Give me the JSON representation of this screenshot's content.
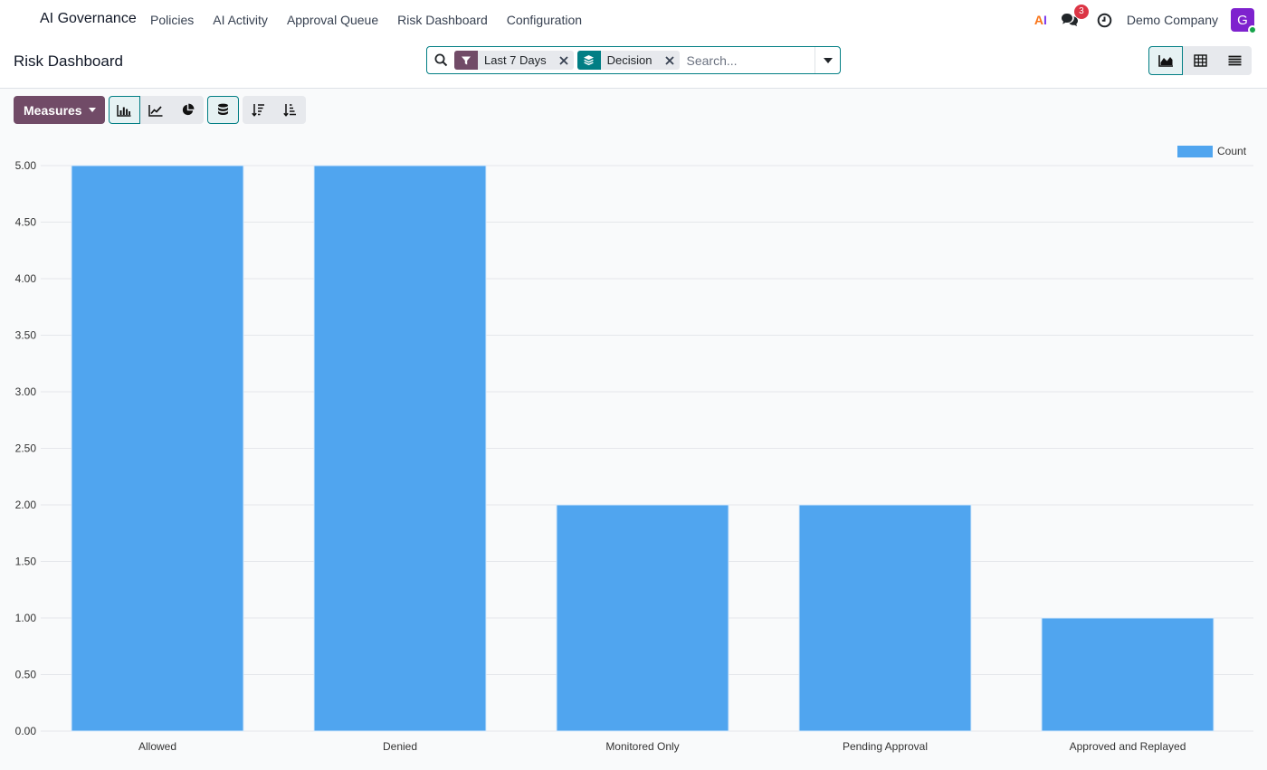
{
  "navbar": {
    "app_name": "AI Governance",
    "menu": [
      "Policies",
      "AI Activity",
      "Approval Queue",
      "Risk Dashboard",
      "Configuration"
    ],
    "messages_count": "3",
    "company": "Demo Company",
    "avatar_initial": "G",
    "ai_logo_a": "A",
    "ai_logo_i": "I"
  },
  "control": {
    "title": "Risk Dashboard",
    "facets": [
      {
        "icon": "filter-icon",
        "label": "Last 7 Days"
      },
      {
        "icon": "layers-icon",
        "label": "Decision"
      }
    ],
    "search_placeholder": "Search..."
  },
  "toolbar": {
    "measures_label": "Measures"
  },
  "colors": {
    "brand": "#714b67",
    "accent": "#017e84",
    "bar": "#50a5ef"
  },
  "chart_data": {
    "type": "bar",
    "categories": [
      "Allowed",
      "Denied",
      "Monitored Only",
      "Pending Approval",
      "Approved and Replayed"
    ],
    "series": [
      {
        "name": "Count",
        "values": [
          5,
          5,
          2,
          2,
          1
        ]
      }
    ],
    "ylim": [
      0,
      5
    ],
    "yticks": [
      "0.00",
      "0.50",
      "1.00",
      "1.50",
      "2.00",
      "2.50",
      "3.00",
      "3.50",
      "4.00",
      "4.50",
      "5.00"
    ],
    "grid": true,
    "legend": "top-right"
  }
}
